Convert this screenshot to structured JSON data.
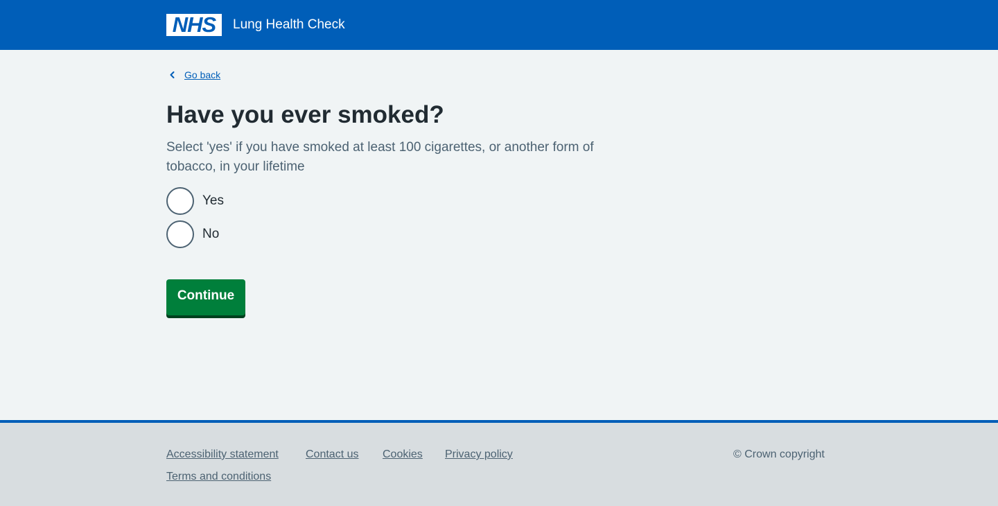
{
  "header": {
    "logo_text": "NHS",
    "service_name": "Lung Health Check"
  },
  "back_link": {
    "label": "Go back"
  },
  "question": {
    "title": "Have you ever smoked?",
    "hint": "Select 'yes' if you have smoked at least 100 cigarettes, or another form of tobacco, in your lifetime",
    "options": [
      {
        "label": "Yes",
        "selected": false
      },
      {
        "label": "No",
        "selected": false
      }
    ]
  },
  "actions": {
    "continue_label": "Continue"
  },
  "footer": {
    "links": [
      "Accessibility statement",
      "Contact us",
      "Cookies",
      "Privacy policy",
      "Terms and conditions"
    ],
    "copyright": "© Crown copyright"
  },
  "colors": {
    "brand_blue": "#005eb8",
    "button_green": "#007f3b",
    "background": "#f0f4f5",
    "footer_bg": "#d8dde0"
  },
  "icons": {
    "back": "chevron-left-icon",
    "logo": "nhs-logo"
  }
}
